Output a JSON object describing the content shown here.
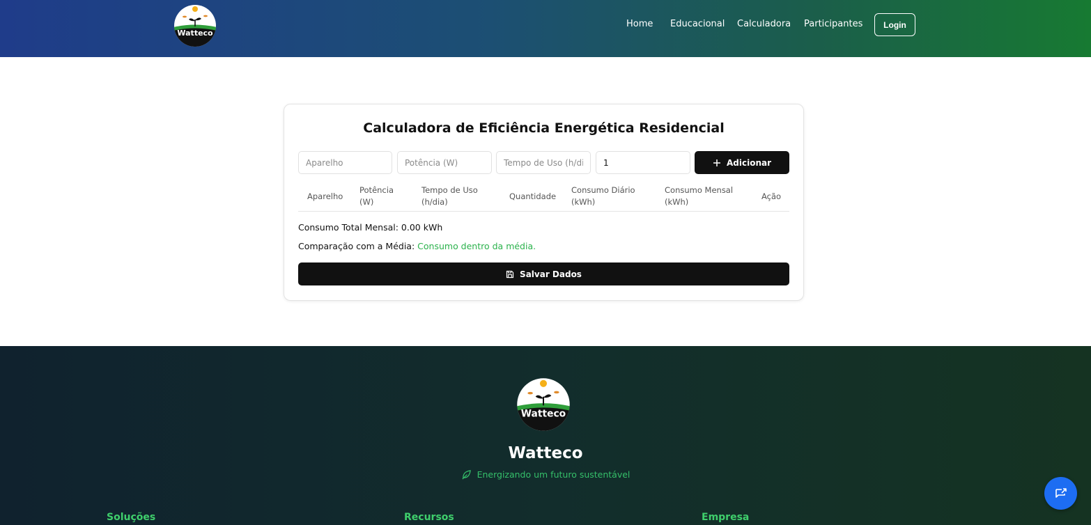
{
  "header": {
    "brand": "Watteco",
    "nav": [
      "Home",
      "Educacional",
      "Calculadora",
      "Participantes"
    ],
    "login_label": "Login"
  },
  "calculator": {
    "title": "Calculadora de Eficiência Energética Residencial",
    "inputs": {
      "device_placeholder": "Aparelho",
      "power_placeholder": "Potência (W)",
      "usage_placeholder": "Tempo de Uso (h/dia)",
      "quantity_value": "1"
    },
    "add_label": "Adicionar",
    "table_headers": [
      "Aparelho",
      "Potência (W)",
      "Tempo de Uso (h/dia)",
      "Quantidade",
      "Consumo Diário (kWh)",
      "Consumo Mensal (kWh)",
      "Ação"
    ],
    "total_label": "Consumo Total Mensal: 0.00 kWh",
    "comparison_label": "Comparação com a Média:",
    "comparison_value": "Consumo dentro da média.",
    "save_label": "Salvar Dados"
  },
  "footer": {
    "brand": "Watteco",
    "tagline": "Energizando um futuro sustentável",
    "columns": [
      "Soluções",
      "Recursos",
      "Empresa"
    ]
  },
  "colors": {
    "accent_green": "#2bb24c",
    "button_dark": "#111111",
    "chat_blue": "#1d6df2"
  }
}
